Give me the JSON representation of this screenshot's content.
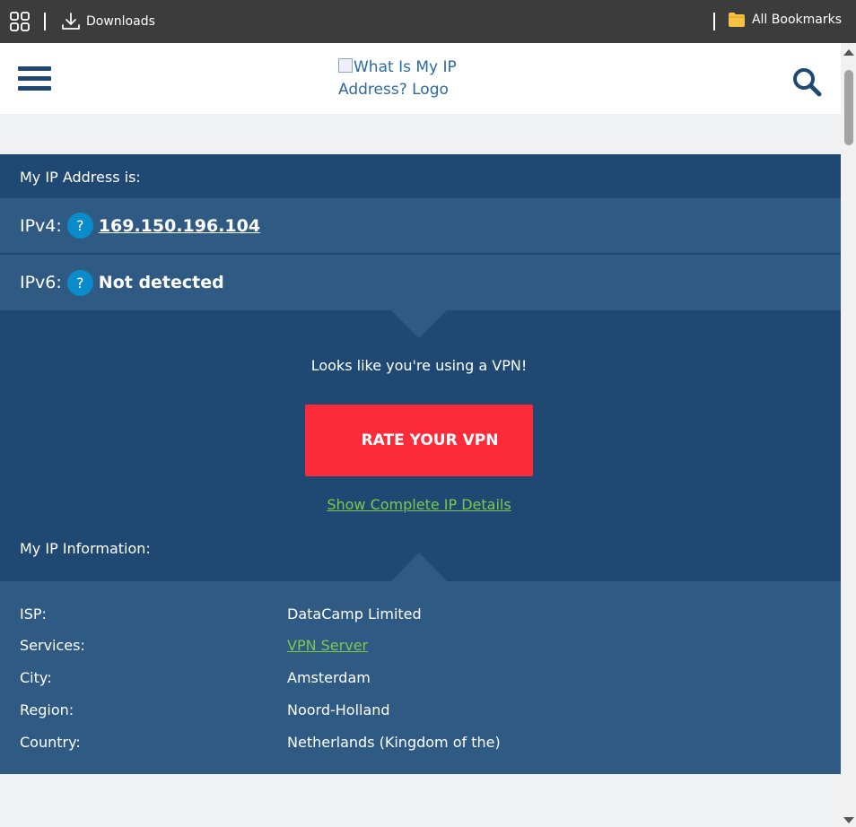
{
  "browser": {
    "downloads_label": "Downloads",
    "all_bookmarks_label": "All Bookmarks"
  },
  "header": {
    "logo_alt": "What Is My IP Address? Logo"
  },
  "ip": {
    "title": "My IP Address is:",
    "ipv4_label": "IPv4:",
    "ipv4_value": "169.150.196.104",
    "ipv6_label": "IPv6:",
    "ipv6_value": "Not detected",
    "help_glyph": "?"
  },
  "vpn": {
    "message": "Looks like you're using a VPN!",
    "button_label": "RATE YOUR VPN",
    "details_link": "Show Complete IP Details",
    "info_title": "My IP Information:"
  },
  "info_rows": [
    {
      "key": "ISP:",
      "value": "DataCamp Limited"
    },
    {
      "key": "Services:",
      "value": "VPN Server"
    },
    {
      "key": "City:",
      "value": "Amsterdam"
    },
    {
      "key": "Region:",
      "value": "Noord-Holland"
    },
    {
      "key": "Country:",
      "value": "Netherlands (Kingdom of the)"
    }
  ],
  "colors": {
    "brand_dark": "#1f4973",
    "brand_mid": "#2e5a84",
    "cta_red": "#fd2a3a",
    "link_green": "#7cc84f",
    "help_blue": "#0a8ccc"
  }
}
